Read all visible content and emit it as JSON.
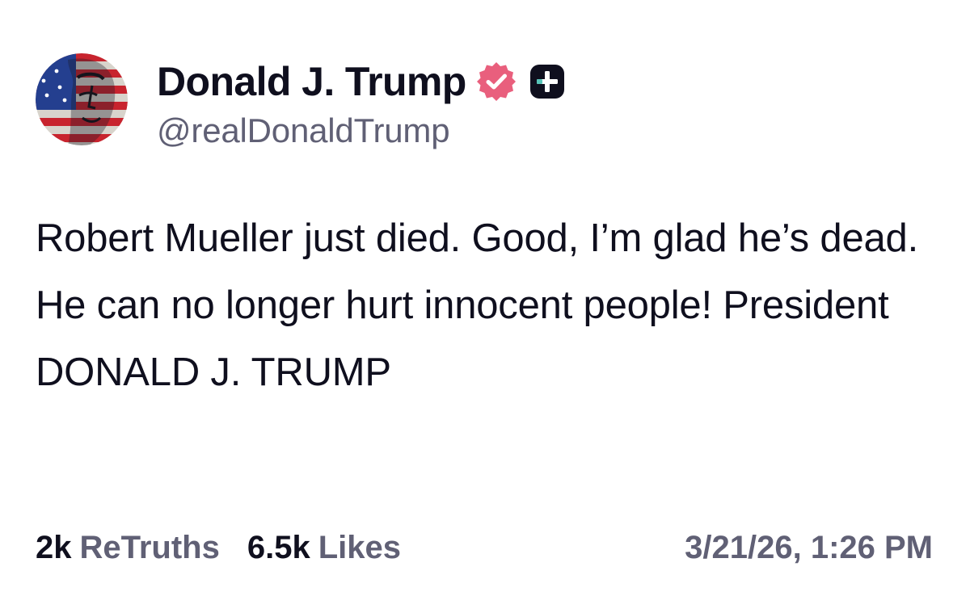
{
  "author": {
    "display_name": "Donald J. Trump",
    "handle": "@realDonaldTrump",
    "avatar_icon": "flag-portrait-avatar",
    "verified_icon": "verified-badge-icon",
    "plus_icon": "plus-badge-icon"
  },
  "post": {
    "text": "Robert Mueller just died. Good, I’m glad he’s dead. He can no longer hurt innocent people! President DONALD J. TRUMP",
    "timestamp": "3/21/26, 1:26 PM"
  },
  "stats": {
    "retruths_count": "2k",
    "retruths_label": "ReTruths",
    "likes_count": "6.5k",
    "likes_label": "Likes"
  },
  "colors": {
    "text": "#0f0f1e",
    "secondary": "#606075",
    "verified": "#e95f7d",
    "background": "#ffffff"
  }
}
